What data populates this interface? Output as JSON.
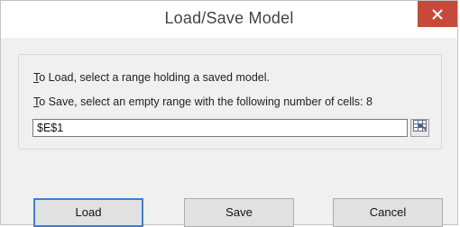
{
  "window": {
    "title": "Load/Save Model"
  },
  "instructions": {
    "load_text": "To Load, select a range holding a saved model.",
    "save_text": "To Save, select an empty range with the following number of cells: 8"
  },
  "range_field": {
    "value": "$E$1"
  },
  "buttons": {
    "load": "Load",
    "save": "Save",
    "cancel": "Cancel"
  },
  "icons": {
    "close": "close-icon",
    "range_select": "range-select-icon"
  },
  "colors": {
    "close_button": "#c7493b",
    "default_button_border": "#3c7fd1",
    "dialog_background": "#f0f0f0"
  }
}
